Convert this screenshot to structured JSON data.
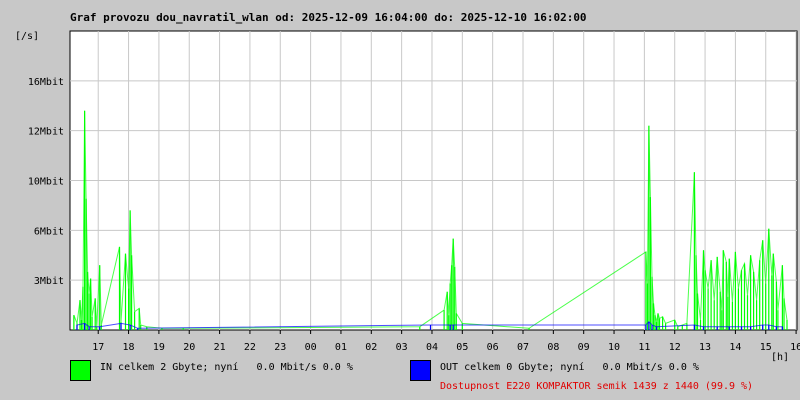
{
  "title": "Graf provozu dou_navratil_wlan od: 2025-12-09 16:04:00 do: 2025-12-10 16:02:00",
  "chart_data": {
    "type": "area",
    "unit_label": "[/s]",
    "xlabel": "[h]",
    "x_tick_labels": [
      "17",
      "18",
      "19",
      "20",
      "21",
      "22",
      "23",
      "00",
      "01",
      "02",
      "03",
      "04",
      "05",
      "06",
      "07",
      "08",
      "09",
      "10",
      "11",
      "12",
      "13",
      "14",
      "15",
      "16"
    ],
    "y_tick_labels": [
      {
        "label": "3Mbit",
        "value": 3
      },
      {
        "label": "6Mbit",
        "value": 6
      },
      {
        "label": "10Mbit",
        "value": 9
      },
      {
        "label": "12Mbit",
        "value": 12
      },
      {
        "label": "16Mbit",
        "value": 15
      }
    ],
    "ylim": [
      0,
      18
    ],
    "xlim": [
      16.07,
      40.03
    ],
    "grid": true,
    "series": [
      {
        "name": "IN",
        "color": "#00ff00",
        "points": [
          [
            16.2,
            0.9
          ],
          [
            16.3,
            0.4
          ],
          [
            16.4,
            1.8
          ],
          [
            16.45,
            0.6
          ],
          [
            16.5,
            2.6
          ],
          [
            16.55,
            13.2
          ],
          [
            16.6,
            7.9
          ],
          [
            16.65,
            3.5
          ],
          [
            16.7,
            2.2
          ],
          [
            16.75,
            3.1
          ],
          [
            16.8,
            0.8
          ],
          [
            16.9,
            1.9
          ],
          [
            16.95,
            0.2
          ],
          [
            17.05,
            3.9
          ],
          [
            17.1,
            0.3
          ],
          [
            17.7,
            5.0
          ],
          [
            17.75,
            0.5
          ],
          [
            17.9,
            4.6
          ],
          [
            18.0,
            2.5
          ],
          [
            18.05,
            7.2
          ],
          [
            18.1,
            4.5
          ],
          [
            18.2,
            1.1
          ],
          [
            18.35,
            1.3
          ],
          [
            18.4,
            0.3
          ],
          [
            18.6,
            0.2
          ],
          [
            19.1,
            0.1
          ],
          [
            19.8,
            0.1
          ],
          [
            27.6,
            0.2
          ],
          [
            28.4,
            1.2
          ],
          [
            28.5,
            2.3
          ],
          [
            28.55,
            0.9
          ],
          [
            28.6,
            2.8
          ],
          [
            28.65,
            3.9
          ],
          [
            28.7,
            5.5
          ],
          [
            28.75,
            3.8
          ],
          [
            28.8,
            1.0
          ],
          [
            29.0,
            0.4
          ],
          [
            31.2,
            0.1
          ],
          [
            35.05,
            4.7
          ],
          [
            35.1,
            2.8
          ],
          [
            35.15,
            12.3
          ],
          [
            35.2,
            8.0
          ],
          [
            35.25,
            3.2
          ],
          [
            35.3,
            1.6
          ],
          [
            35.35,
            0.9
          ],
          [
            35.4,
            0.5
          ],
          [
            35.45,
            1.0
          ],
          [
            35.5,
            0.7
          ],
          [
            35.6,
            0.8
          ],
          [
            35.7,
            0.4
          ],
          [
            36.0,
            0.6
          ],
          [
            36.1,
            0.2
          ],
          [
            36.25,
            0.3
          ],
          [
            36.4,
            0.4
          ],
          [
            36.65,
            9.5
          ],
          [
            36.7,
            4.5
          ],
          [
            36.75,
            2.2
          ],
          [
            36.85,
            0.6
          ],
          [
            36.95,
            4.8
          ],
          [
            37.0,
            3.6
          ],
          [
            37.1,
            2.5
          ],
          [
            37.2,
            4.2
          ],
          [
            37.3,
            1.8
          ],
          [
            37.4,
            4.4
          ],
          [
            37.5,
            2.3
          ],
          [
            37.55,
            1.2
          ],
          [
            37.6,
            4.8
          ],
          [
            37.7,
            4.1
          ],
          [
            37.75,
            2.0
          ],
          [
            37.8,
            4.3
          ],
          [
            37.9,
            1.7
          ],
          [
            38.0,
            4.7
          ],
          [
            38.1,
            2.5
          ],
          [
            38.2,
            3.6
          ],
          [
            38.3,
            4.0
          ],
          [
            38.4,
            2.1
          ],
          [
            38.5,
            4.5
          ],
          [
            38.6,
            3.5
          ],
          [
            38.7,
            1.8
          ],
          [
            38.8,
            4.2
          ],
          [
            38.9,
            5.4
          ],
          [
            39.0,
            2.8
          ],
          [
            39.1,
            6.1
          ],
          [
            39.2,
            3.3
          ],
          [
            39.25,
            4.6
          ],
          [
            39.35,
            2.9
          ],
          [
            39.4,
            1.2
          ],
          [
            39.55,
            3.9
          ],
          [
            39.6,
            1.9
          ],
          [
            39.7,
            0.6
          ]
        ]
      },
      {
        "name": "OUT",
        "color": "#0000ff",
        "points": [
          [
            16.3,
            0.3
          ],
          [
            16.55,
            0.4
          ],
          [
            16.7,
            0.2
          ],
          [
            17.05,
            0.2
          ],
          [
            17.75,
            0.4
          ],
          [
            18.05,
            0.3
          ],
          [
            18.3,
            0.1
          ],
          [
            27.95,
            0.3
          ],
          [
            28.6,
            0.3
          ],
          [
            28.7,
            0.3
          ],
          [
            35.05,
            0.3
          ],
          [
            35.15,
            0.5
          ],
          [
            35.25,
            0.3
          ],
          [
            35.4,
            0.2
          ],
          [
            36.65,
            0.3
          ],
          [
            36.95,
            0.2
          ],
          [
            37.4,
            0.2
          ],
          [
            37.8,
            0.2
          ],
          [
            38.2,
            0.2
          ],
          [
            38.5,
            0.2
          ],
          [
            38.9,
            0.3
          ],
          [
            39.1,
            0.3
          ],
          [
            39.35,
            0.2
          ],
          [
            39.55,
            0.2
          ]
        ]
      }
    ]
  },
  "legend": {
    "in_text": "IN celkem 2 Gbyte; nyní   0.0 Mbit/s 0.0 %",
    "out_text": "OUT celkem 0 Gbyte; nyní   0.0 Mbit/s 0.0 %",
    "in_color": "#00ff00",
    "out_color": "#0000ff"
  },
  "availability": "Dostupnost E220 KOMPAKTOR semik 1439 z 1440 (99.9 %)"
}
